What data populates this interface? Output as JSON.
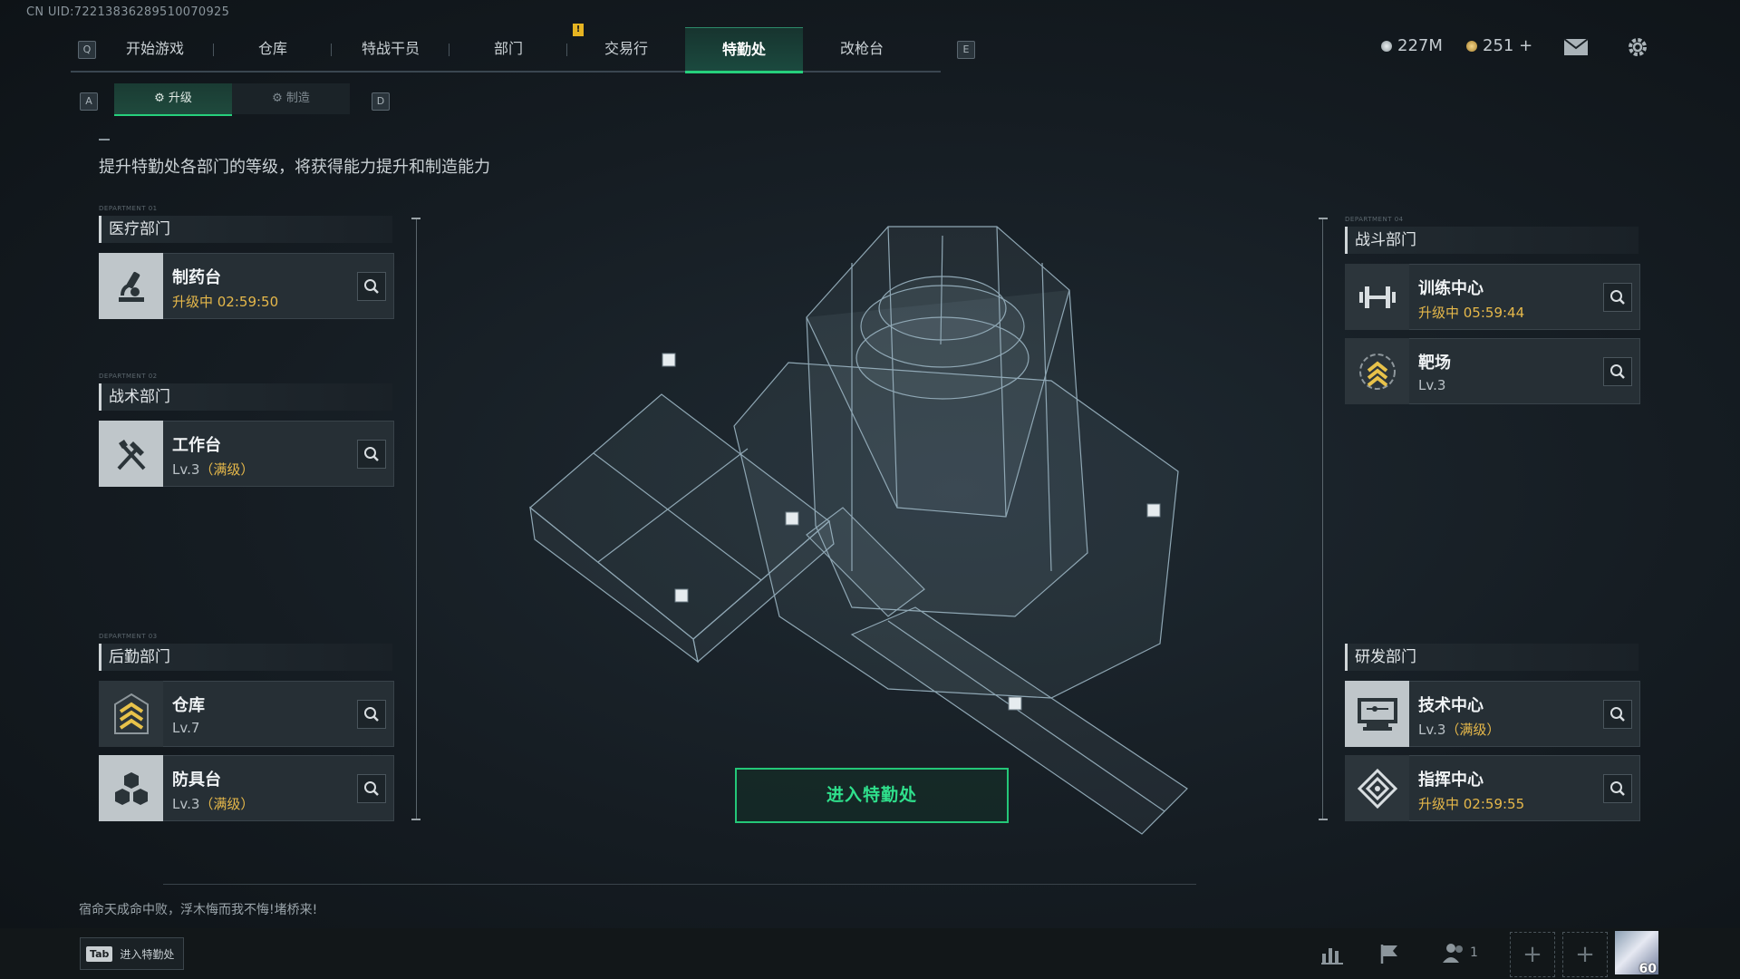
{
  "uid": "CN UID:72213836289510070925",
  "nav": {
    "left_key": "Q",
    "right_key": "E",
    "tabs": [
      "开始游戏",
      "仓库",
      "特战干员",
      "部门",
      "交易行",
      "特勤处",
      "改枪台"
    ],
    "active": "特勤处"
  },
  "notice_badge": "!",
  "currency": {
    "silver": "227M",
    "gold": "251 +"
  },
  "subtabs": {
    "left_key": "A",
    "right_key": "D",
    "items": [
      "升级",
      "制造"
    ],
    "active": "升级"
  },
  "description": "提升特勤处各部门的等级，将获得能力提升和制造能力",
  "departments": {
    "medical": {
      "tag": "DEPARTMENT 01",
      "title": "医疗部门",
      "facilities": [
        {
          "name": "制药台",
          "status": "升级中 02:59:50",
          "icon": "medicine-icon"
        }
      ]
    },
    "tactical": {
      "tag": "DEPARTMENT 02",
      "title": "战术部门",
      "facilities": [
        {
          "name": "工作台",
          "level": "Lv.3",
          "maxed": "（满级）",
          "icon": "tools-icon"
        }
      ]
    },
    "logistics": {
      "tag": "DEPARTMENT 03",
      "title": "后勤部门",
      "facilities": [
        {
          "name": "仓库",
          "level": "Lv.7",
          "icon": "chevron-rank-icon"
        },
        {
          "name": "防具台",
          "level": "Lv.3",
          "maxed": "（满级）",
          "icon": "cubes-icon"
        }
      ]
    },
    "combat": {
      "tag": "DEPARTMENT 04",
      "title": "战斗部门",
      "facilities": [
        {
          "name": "训练中心",
          "status": "升级中 05:59:44",
          "icon": "dumbbell-icon"
        },
        {
          "name": "靶场",
          "level": "Lv.3",
          "icon": "target-rank-icon"
        }
      ]
    },
    "research": {
      "title": "研发部门",
      "facilities": [
        {
          "name": "技术中心",
          "level": "Lv.3",
          "maxed": "（满级）",
          "icon": "monitor-icon"
        },
        {
          "name": "指挥中心",
          "status": "升级中 02:59:55",
          "icon": "command-icon"
        }
      ]
    }
  },
  "enter_button": "进入特勤处",
  "tip": "宿命天成命中败，浮木悔而我不悔!堵桥来!",
  "bottom": {
    "tab_key": "Tab",
    "tab_label": "进入特勤处",
    "party_count": "1",
    "player_level": "60"
  },
  "colors": {
    "accent": "#26d07c",
    "upgrading": "#e6b84a",
    "panel": "#262f35"
  }
}
